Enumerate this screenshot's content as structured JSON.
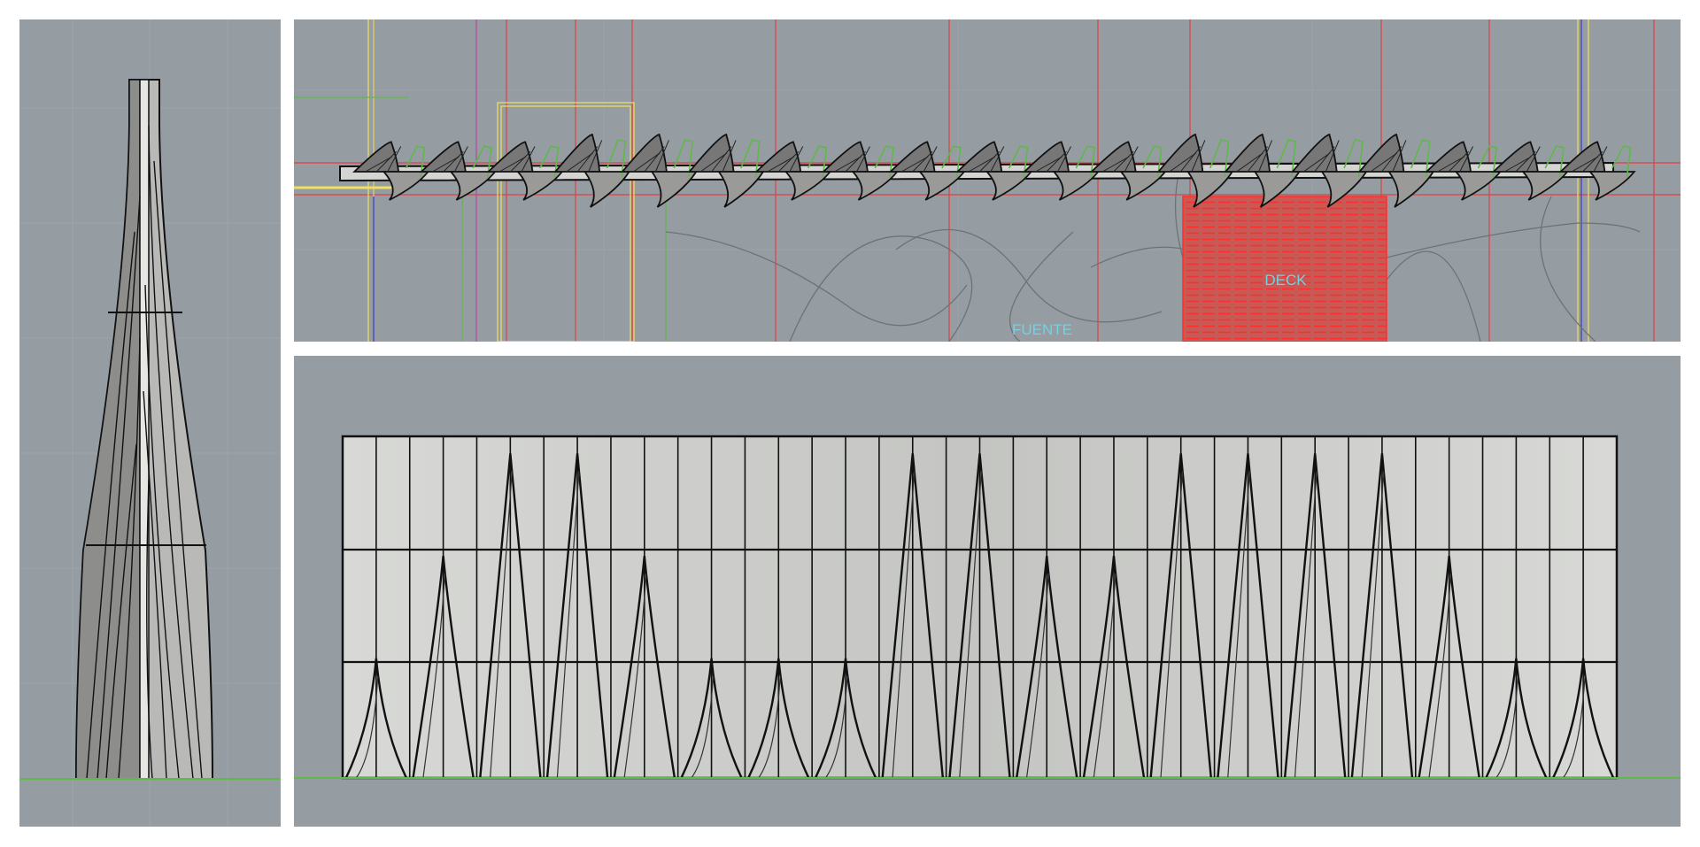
{
  "viewports": {
    "left": {
      "label": ""
    },
    "top": {
      "label": ""
    },
    "bottom": {
      "label": ""
    }
  },
  "plan_labels": {
    "deck": "DECK",
    "fuente": "FUENTE"
  },
  "colors": {
    "viewport_bg": "#959da3",
    "grid": "#a3aaaf",
    "surface": "#cfd0cd",
    "edge": "#111111",
    "hatch_red": "#e04040",
    "ground_green": "#5fb84a",
    "label_cyan": "#6fd3e6"
  }
}
